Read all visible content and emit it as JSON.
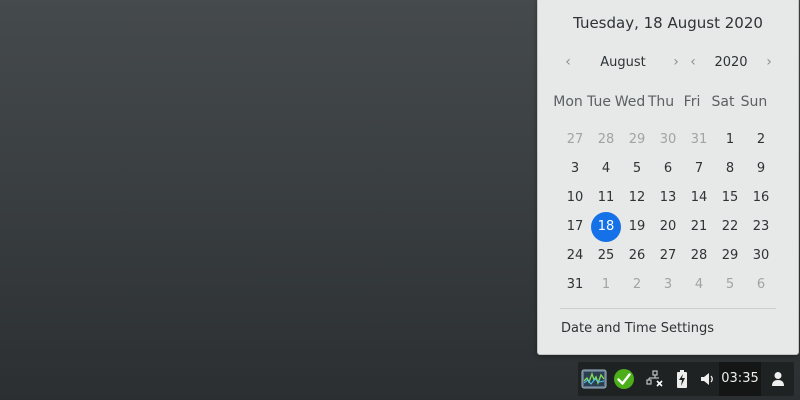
{
  "calendar": {
    "heading": "Tuesday, 18 August 2020",
    "month_nav": {
      "prev": "‹",
      "label": "August",
      "next": "›"
    },
    "year_nav": {
      "prev": "‹",
      "label": "2020",
      "next": "›"
    },
    "weekdays": [
      "Mon",
      "Tue",
      "Wed",
      "Thu",
      "Fri",
      "Sat",
      "Sun"
    ],
    "weeks": [
      [
        {
          "d": "27",
          "o": true
        },
        {
          "d": "28",
          "o": true
        },
        {
          "d": "29",
          "o": true
        },
        {
          "d": "30",
          "o": true
        },
        {
          "d": "31",
          "o": true
        },
        {
          "d": "1"
        },
        {
          "d": "2"
        }
      ],
      [
        {
          "d": "3"
        },
        {
          "d": "4"
        },
        {
          "d": "5"
        },
        {
          "d": "6"
        },
        {
          "d": "7"
        },
        {
          "d": "8"
        },
        {
          "d": "9"
        }
      ],
      [
        {
          "d": "10"
        },
        {
          "d": "11"
        },
        {
          "d": "12"
        },
        {
          "d": "13"
        },
        {
          "d": "14"
        },
        {
          "d": "15"
        },
        {
          "d": "16"
        }
      ],
      [
        {
          "d": "17"
        },
        {
          "d": "18",
          "today": true
        },
        {
          "d": "19"
        },
        {
          "d": "20"
        },
        {
          "d": "21"
        },
        {
          "d": "22"
        },
        {
          "d": "23"
        }
      ],
      [
        {
          "d": "24"
        },
        {
          "d": "25"
        },
        {
          "d": "26"
        },
        {
          "d": "27"
        },
        {
          "d": "28"
        },
        {
          "d": "29"
        },
        {
          "d": "30"
        }
      ],
      [
        {
          "d": "31"
        },
        {
          "d": "1",
          "o": true
        },
        {
          "d": "2",
          "o": true
        },
        {
          "d": "3",
          "o": true
        },
        {
          "d": "4",
          "o": true
        },
        {
          "d": "5",
          "o": true
        },
        {
          "d": "6",
          "o": true
        }
      ]
    ],
    "settings_label": "Date and Time Settings",
    "colors": {
      "today_bg": "#1471e8",
      "other_month": "#a0a4a5"
    }
  },
  "tray": {
    "icons": [
      "system-monitor-icon",
      "update-check-icon",
      "network-disconnected-icon",
      "battery-charging-icon",
      "volume-icon",
      "user-icon"
    ],
    "clock": "03:35",
    "colors": {
      "check_green": "#4caf1a"
    }
  }
}
